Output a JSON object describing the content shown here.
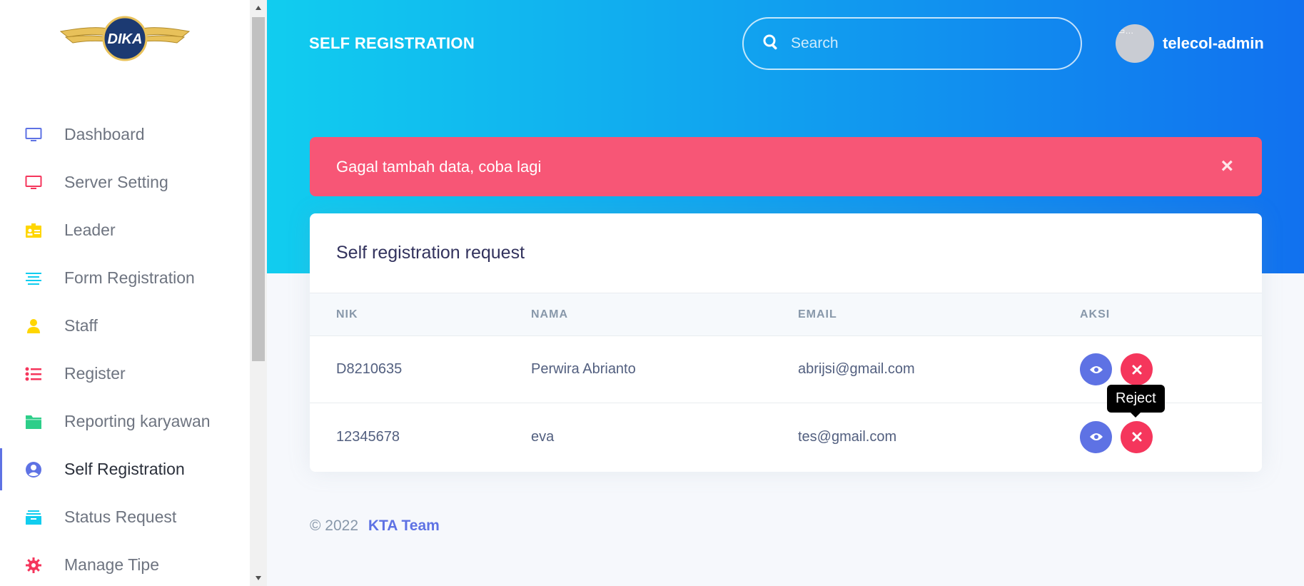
{
  "brand": {
    "logo_text": "DIKA"
  },
  "sidebar": {
    "items": [
      {
        "label": "Dashboard",
        "icon": "monitor-icon",
        "color": "#5e72e4"
      },
      {
        "label": "Server Setting",
        "icon": "monitor-icon",
        "color": "#f5365c"
      },
      {
        "label": "Leader",
        "icon": "id-card-icon",
        "color": "#ffd600"
      },
      {
        "label": "Form Registration",
        "icon": "align-center-icon",
        "color": "#11cdef"
      },
      {
        "label": "Staff",
        "icon": "user-icon",
        "color": "#ffd600"
      },
      {
        "label": "Register",
        "icon": "list-icon",
        "color": "#f5365c"
      },
      {
        "label": "Reporting karyawan",
        "icon": "folder-icon",
        "color": "#2dce89"
      },
      {
        "label": "Self Registration",
        "icon": "user-circle-icon",
        "color": "#5e72e4"
      },
      {
        "label": "Status Request",
        "icon": "archive-icon",
        "color": "#11cdef"
      },
      {
        "label": "Manage Tipe",
        "icon": "gear-icon",
        "color": "#f5365c"
      }
    ]
  },
  "header": {
    "title": "SELF REGISTRATION",
    "search_placeholder": "Search",
    "username": "telecol-admin"
  },
  "alert": {
    "message": "Gagal tambah data, coba lagi",
    "close": "×"
  },
  "card": {
    "title": "Self registration request",
    "columns": [
      "NIK",
      "NAMA",
      "EMAIL",
      "AKSI"
    ],
    "rows": [
      {
        "nik": "D8210635",
        "nama": "Perwira Abrianto",
        "email": "abrijsi@gmail.com"
      },
      {
        "nik": "12345678",
        "nama": "eva",
        "email": "tes@gmail.com"
      }
    ]
  },
  "tooltip": {
    "text": "Reject"
  },
  "footer": {
    "copyright": "© 2022",
    "team": "KTA Team"
  }
}
